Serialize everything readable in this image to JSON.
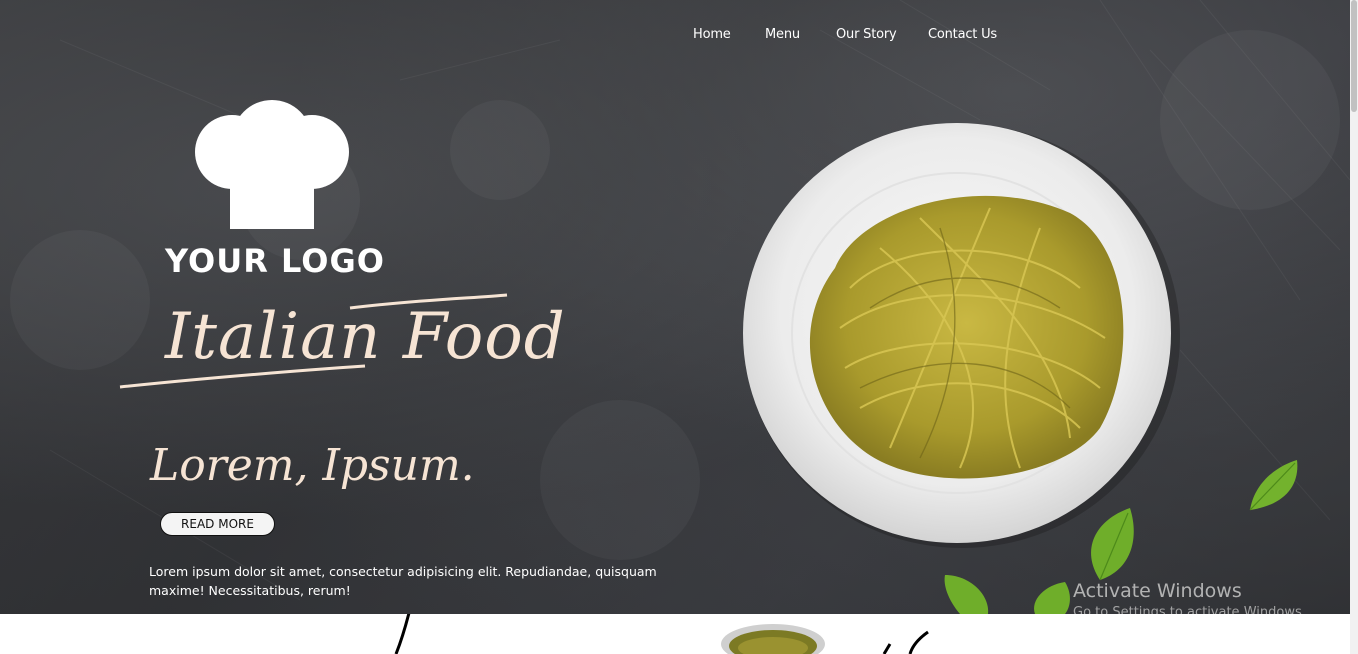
{
  "nav": {
    "items": [
      {
        "label": "Home"
      },
      {
        "label": "Menu"
      },
      {
        "label": "Our Story"
      },
      {
        "label": "Contact Us"
      }
    ]
  },
  "hero": {
    "logo_text": "YOUR LOGO",
    "logo_icon": "chef-hat-icon",
    "title": "Italian Food",
    "subtitle": "Lorem, Ipsum.",
    "button_label": "READ MORE",
    "description": "Lorem ipsum dolor sit amet, consectetur adipisicing elit. Repudiandae, quisquam maxime! Necessitatibus, rerum!"
  },
  "watermark": {
    "title": "Activate Windows",
    "subtitle": "Go to Settings to activate Windows."
  },
  "colors": {
    "background": "#2f3033",
    "script_text": "#f6e4d4",
    "button_bg": "#f4f4f4",
    "plate": "#ececec",
    "pasta": "#b9a936",
    "leaf": "#6fae2a"
  }
}
